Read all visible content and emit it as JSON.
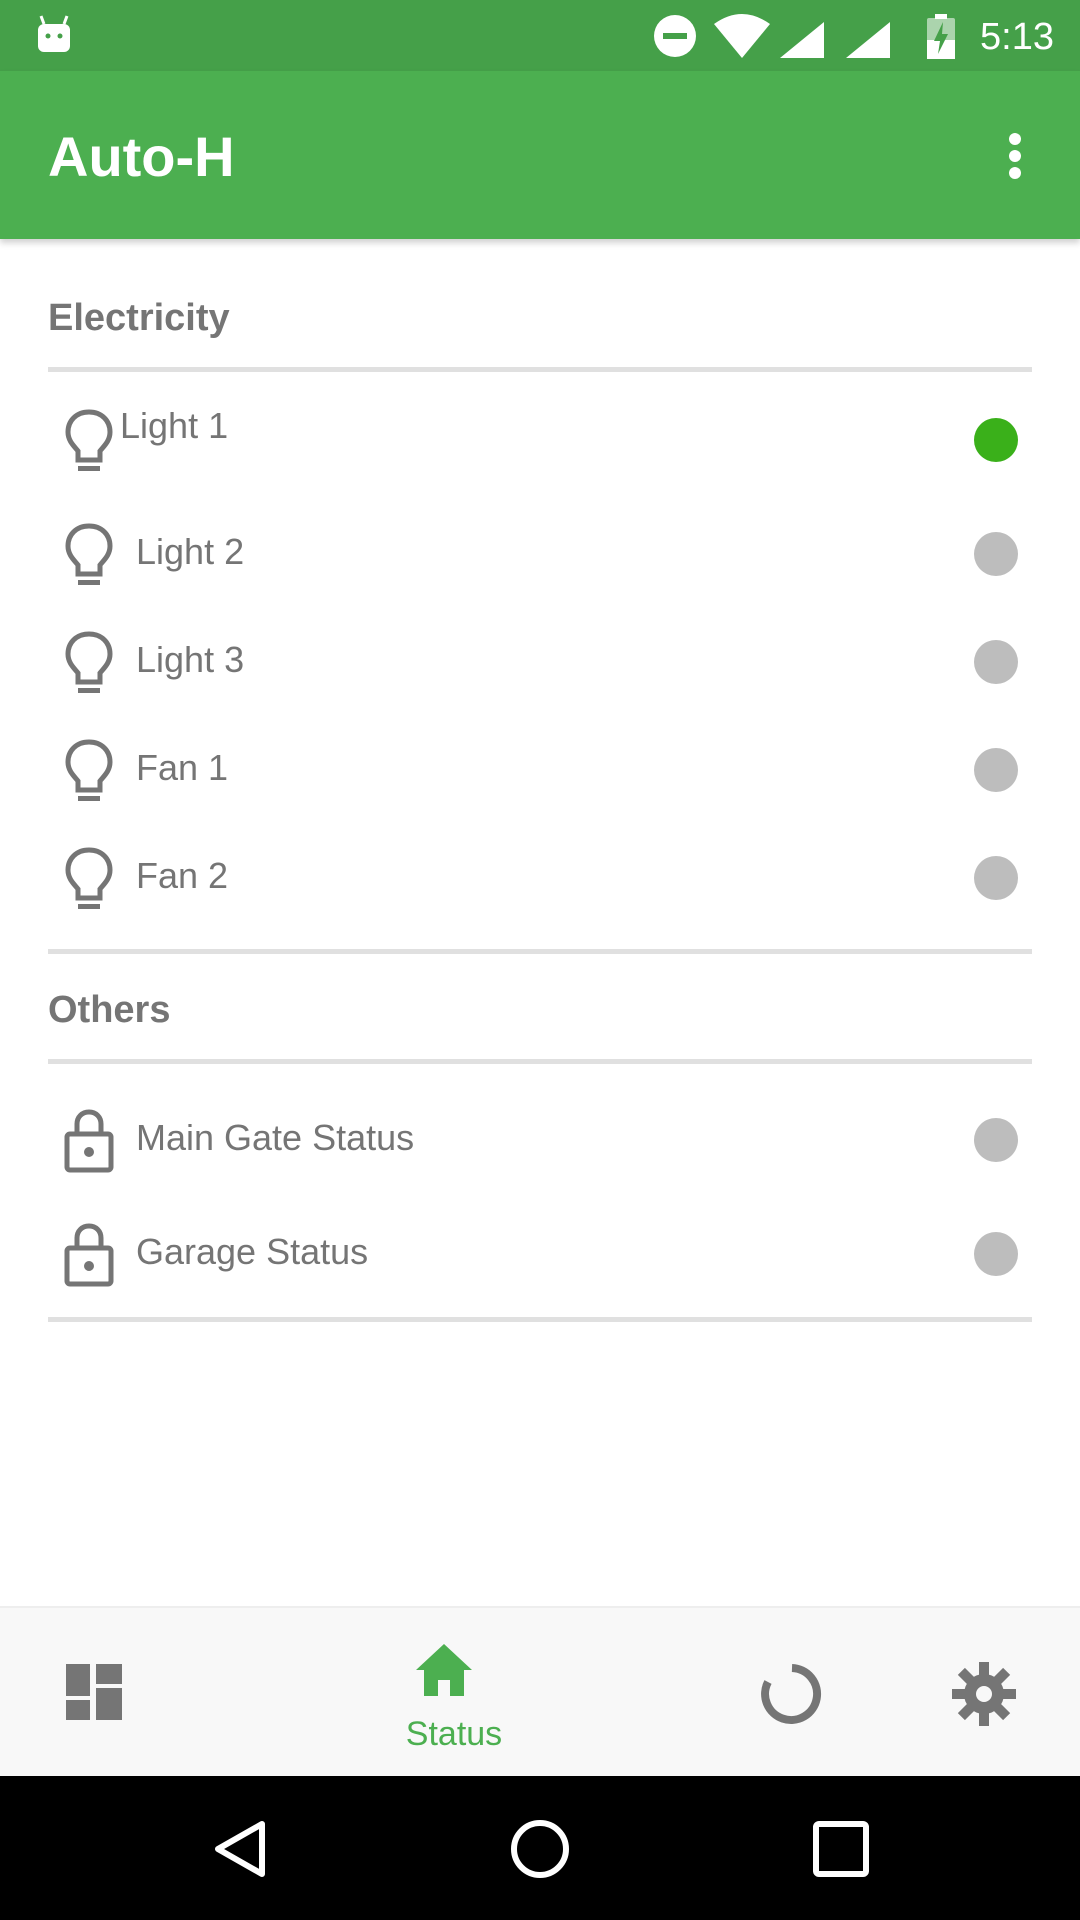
{
  "status_bar": {
    "time": "5:13",
    "icons": [
      "android-icon",
      "do-not-disturb-icon",
      "wifi-icon",
      "signal-icon",
      "signal-icon",
      "battery-charging-icon"
    ]
  },
  "app_bar": {
    "title": "Auto-H",
    "menu_icon": "more-vert-icon"
  },
  "sections": [
    {
      "title": "Electricity",
      "items": [
        {
          "label": "Light 1",
          "icon": "lightbulb-icon",
          "on": true
        },
        {
          "label": "Light 2",
          "icon": "lightbulb-icon",
          "on": false
        },
        {
          "label": "Light 3",
          "icon": "lightbulb-icon",
          "on": false
        },
        {
          "label": "Fan 1",
          "icon": "lightbulb-icon",
          "on": false
        },
        {
          "label": "Fan 2",
          "icon": "lightbulb-icon",
          "on": false
        }
      ]
    },
    {
      "title": "Others",
      "items": [
        {
          "label": "Main Gate Status",
          "icon": "lock-icon",
          "on": false
        },
        {
          "label": "Garage Status",
          "icon": "lock-icon",
          "on": false
        }
      ]
    }
  ],
  "bottom_nav": {
    "items": [
      {
        "icon": "dashboard-icon",
        "label": ""
      },
      {
        "icon": "home-icon",
        "label": "Status",
        "active": true
      },
      {
        "icon": "progress-icon",
        "label": ""
      },
      {
        "icon": "gear-icon",
        "label": ""
      }
    ]
  },
  "system_nav": [
    "back-icon",
    "home-circle-icon",
    "recents-icon"
  ],
  "colors": {
    "primary": "#4caf50",
    "primary_dark": "#45a049",
    "indicator_on": "#3ab01a",
    "indicator_off": "#bdbdbd",
    "text": "#757575"
  }
}
